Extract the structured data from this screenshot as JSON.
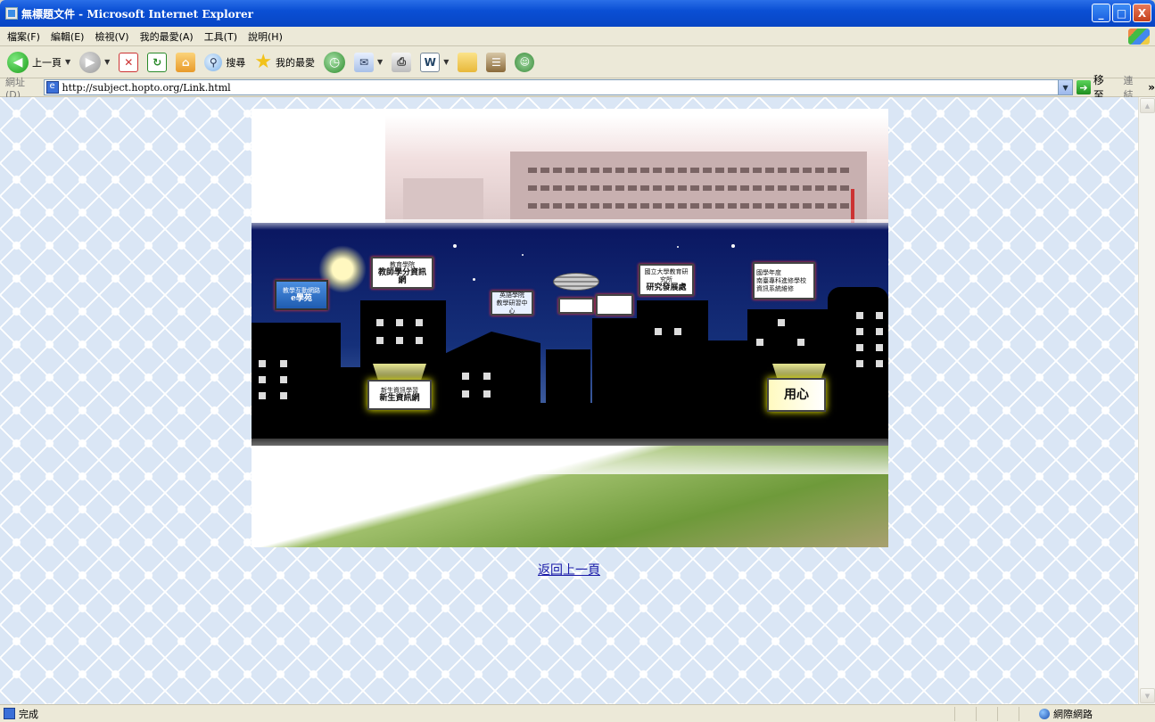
{
  "window": {
    "title": "無標題文件 - Microsoft Internet Explorer",
    "controls": {
      "minimize": "_",
      "maximize": "□",
      "close": "X"
    }
  },
  "menu": {
    "items": [
      "檔案(F)",
      "編輯(E)",
      "檢視(V)",
      "我的最愛(A)",
      "工具(T)",
      "說明(H)"
    ]
  },
  "toolbar": {
    "back_label": "上一頁",
    "search_label": "搜尋",
    "favorites_label": "我的最愛"
  },
  "address": {
    "label": "網址(D)",
    "url": "http://subject.hopto.org/Link.html",
    "go_label": "移至",
    "links_label": "連結"
  },
  "content": {
    "back_link": "返回上一頁",
    "signs": {
      "elearning_top": "教學互動網路",
      "elearning_main": "e學苑",
      "teacher_top": "教育學院",
      "teacher_main": "教師學分資訊網",
      "mid_top": "英語學院",
      "mid_main": "教學研習中心",
      "research_top": "國立大學教育研究所",
      "research_main": "研究發展處",
      "school_top": "國學年度",
      "school_mid": "南臺專科進修學校",
      "school_bot": "資訊系統維修",
      "freshman_top": "新生資訊學習",
      "freshman_main": "新生資訊網",
      "heart_main": "用心"
    }
  },
  "status": {
    "text": "完成",
    "zone": "網際網路"
  }
}
